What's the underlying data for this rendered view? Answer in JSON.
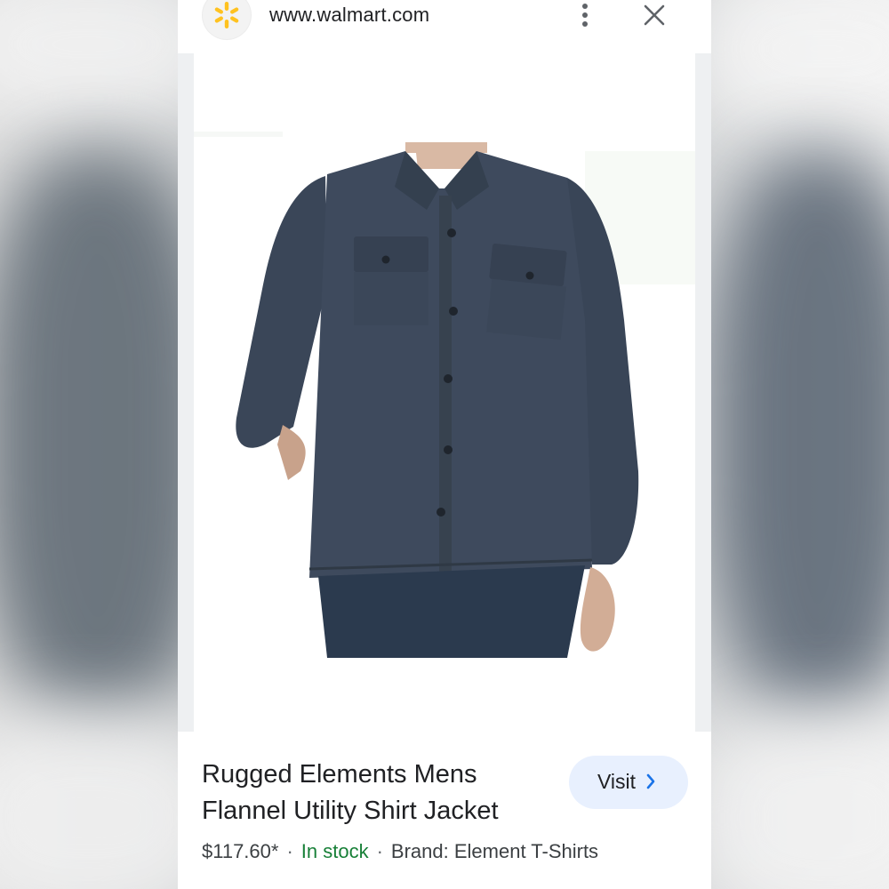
{
  "header": {
    "url": "www.walmart.com",
    "logo_icon": "walmart-spark-icon",
    "menu_icon": "more-vert-icon",
    "close_icon": "close-icon"
  },
  "product": {
    "title": "Rugged Elements Mens Flannel Utility Shirt Jacket",
    "price": "$117.60*",
    "availability": "In stock",
    "brand": "Brand: Element T-Shirts",
    "separator": "·"
  },
  "actions": {
    "visit_label": "Visit",
    "visit_icon": "chevron-right-icon"
  },
  "colors": {
    "accent_button_bg": "#e8f0fe",
    "in_stock": "#188038",
    "walmart_spark": "#ffc220",
    "jacket": "#3d4a5c"
  }
}
